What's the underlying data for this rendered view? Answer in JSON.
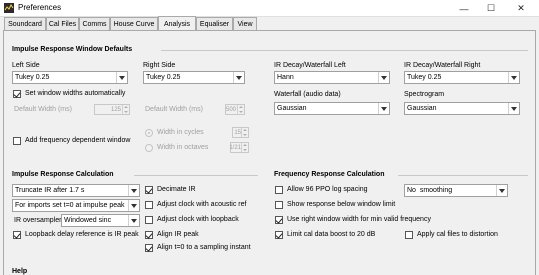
{
  "window": {
    "title": "Preferences",
    "minimize": "—",
    "maximize": "☐",
    "close": "✕"
  },
  "tabs": [
    "Soundcard",
    "Cal Files",
    "Comms",
    "House Curve",
    "Analysis",
    "Equaliser",
    "View"
  ],
  "active_tab": "Analysis",
  "irw": {
    "title": "Impulse Response Window Defaults",
    "left_side_label": "Left Side",
    "left_side_value": "Tukey 0.25",
    "right_side_label": "Right Side",
    "right_side_value": "Tukey 0.25",
    "set_auto_label": "Set window widths automatically",
    "set_auto_checked": true,
    "default_width_label": "Default Width (ms)",
    "left_width_value": "125",
    "right_width_value": "500",
    "add_freq_label": "Add frequency dependent window",
    "add_freq_checked": false,
    "width_cycles_label": "Width in cycles",
    "width_cycles_value": "15",
    "width_octaves_label": "Width in octaves",
    "width_octaves_value": "1/21",
    "ir_decay_left_label": "IR Decay/Waterfall Left",
    "ir_decay_left_value": "Hann",
    "ir_decay_right_label": "IR Decay/Waterfall Right",
    "ir_decay_right_value": "Tukey 0.25",
    "waterfall_label": "Waterfall (audio data)",
    "waterfall_value": "Gaussian",
    "spectrogram_label": "Spectrogram",
    "spectrogram_value": "Gaussian"
  },
  "irc": {
    "title": "Impulse Response Calculation",
    "truncate_value": "Truncate IR after 1.7 s",
    "imports_value": "For imports set t=0 at impulse peak",
    "oversampler_label": "IR oversampler:",
    "oversampler_value": "Windowed sinc",
    "loopback_label": "Loopback delay reference is IR peak",
    "loopback_checked": true,
    "decimate_label": "Decimate IR",
    "decimate_checked": true,
    "adjust_acoustic_label": "Adjust clock with acoustic ref",
    "adjust_acoustic_checked": false,
    "adjust_loopback_label": "Adjust clock with loopback",
    "adjust_loopback_checked": false,
    "align_ir_label": "Align IR peak",
    "align_ir_checked": true,
    "align_t0_label": "Align t=0 to a sampling instant",
    "align_t0_checked": true
  },
  "frc": {
    "title": "Frequency Response Calculation",
    "allow96_label": "Allow 96 PPO log spacing",
    "allow96_checked": false,
    "smoothing_value": "No  smoothing",
    "show_below_label": "Show response below window limit",
    "show_below_checked": false,
    "use_right_label": "Use right window width for min valid frequency",
    "use_right_checked": true,
    "limit_cal_label": "Limit cal data boost to 20 dB",
    "limit_cal_checked": true,
    "apply_cal_label": "Apply cal files to distortion",
    "apply_cal_checked": false
  },
  "help": {
    "title": "Help"
  }
}
